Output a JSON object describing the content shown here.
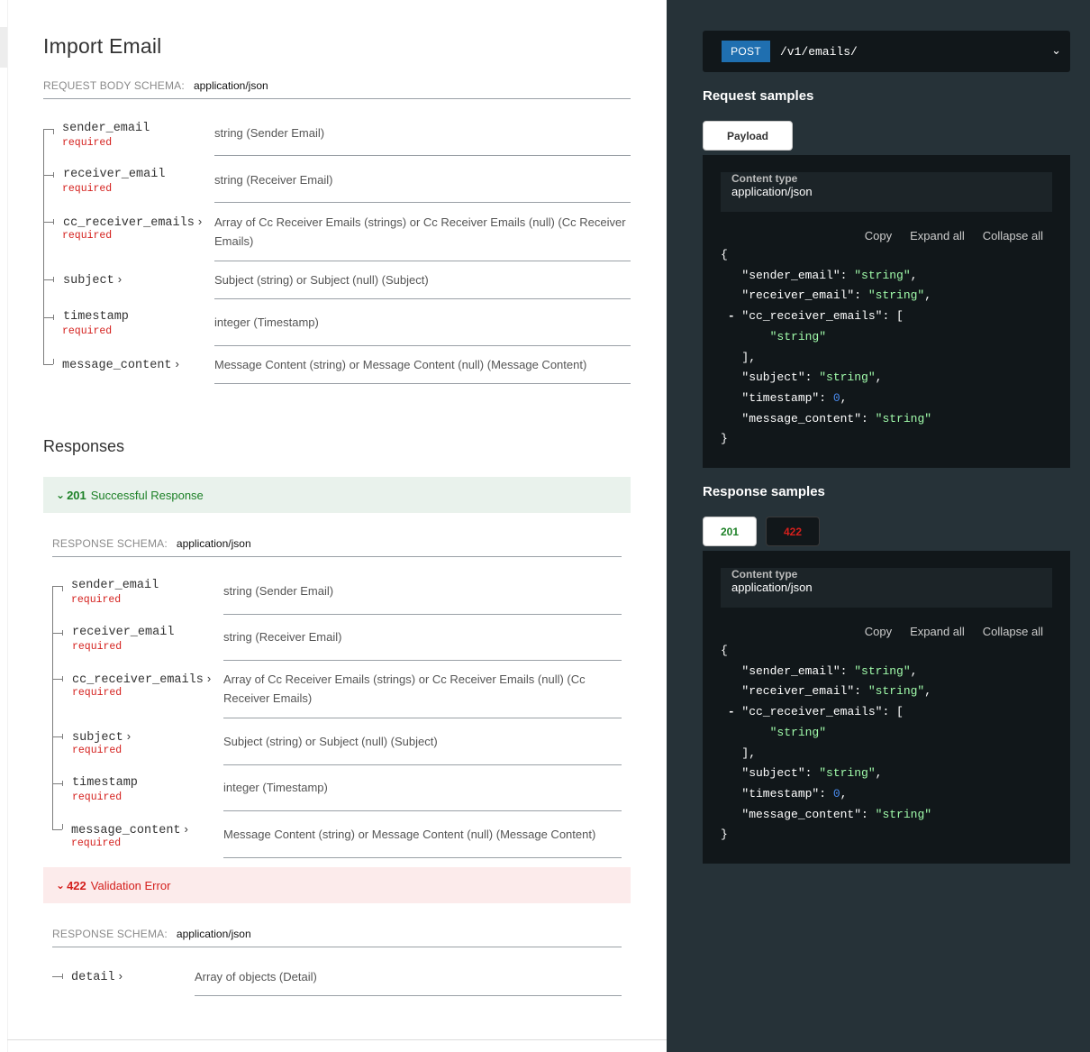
{
  "title": "Import Email",
  "request": {
    "schema_label": "REQUEST BODY SCHEMA:",
    "schema_type": "application/json",
    "fields": [
      {
        "name": "sender_email",
        "required": "required",
        "desc": "string (Sender Email)"
      },
      {
        "name": "receiver_email",
        "required": "required",
        "desc": "string (Receiver Email)"
      },
      {
        "name": "cc_receiver_emails",
        "required": "required",
        "desc": "Array of Cc Receiver Emails (strings) or Cc Receiver Emails (null) (Cc Receiver Emails)"
      },
      {
        "name": "subject",
        "required": "",
        "desc": "Subject (string) or Subject (null) (Subject)"
      },
      {
        "name": "timestamp",
        "required": "required",
        "desc": "integer (Timestamp)"
      },
      {
        "name": "message_content",
        "required": "",
        "desc": "Message Content (string) or Message Content (null) (Message Content)"
      }
    ]
  },
  "responses_title": "Responses",
  "resp201": {
    "code": "201",
    "text": "Successful Response",
    "schema_label": "RESPONSE SCHEMA:",
    "schema_type": "application/json",
    "fields": [
      {
        "name": "sender_email",
        "required": "required",
        "desc": "string (Sender Email)"
      },
      {
        "name": "receiver_email",
        "required": "required",
        "desc": "string (Receiver Email)"
      },
      {
        "name": "cc_receiver_emails",
        "required": "required",
        "desc": "Array of Cc Receiver Emails (strings) or Cc Receiver Emails (null) (Cc Receiver Emails)"
      },
      {
        "name": "subject",
        "required": "required",
        "desc": "Subject (string) or Subject (null) (Subject)"
      },
      {
        "name": "timestamp",
        "required": "required",
        "desc": "integer (Timestamp)"
      },
      {
        "name": "message_content",
        "required": "required",
        "desc": "Message Content (string) or Message Content (null) (Message Content)"
      }
    ]
  },
  "resp422": {
    "code": "422",
    "text": "Validation Error",
    "schema_label": "RESPONSE SCHEMA:",
    "schema_type": "application/json",
    "fields": [
      {
        "name": "detail",
        "required": "",
        "desc": "Array of objects (Detail)"
      }
    ]
  },
  "right": {
    "method": "POST",
    "path": "/v1/emails/",
    "request_samples": "Request samples",
    "payload_tab": "Payload",
    "response_samples": "Response samples",
    "tab_201": "201",
    "tab_422": "422",
    "content_type_label": "Content type",
    "content_type_value": "application/json",
    "copy": "Copy",
    "expand_all": "Expand all",
    "collapse_all": "Collapse all"
  },
  "colors": {
    "success": "#1d8127",
    "error": "#d41f1c",
    "method_bg": "#1f6fb0",
    "panel_bg": "#263238",
    "json_string": "#a0fbaa",
    "json_number": "#4a8bee"
  }
}
